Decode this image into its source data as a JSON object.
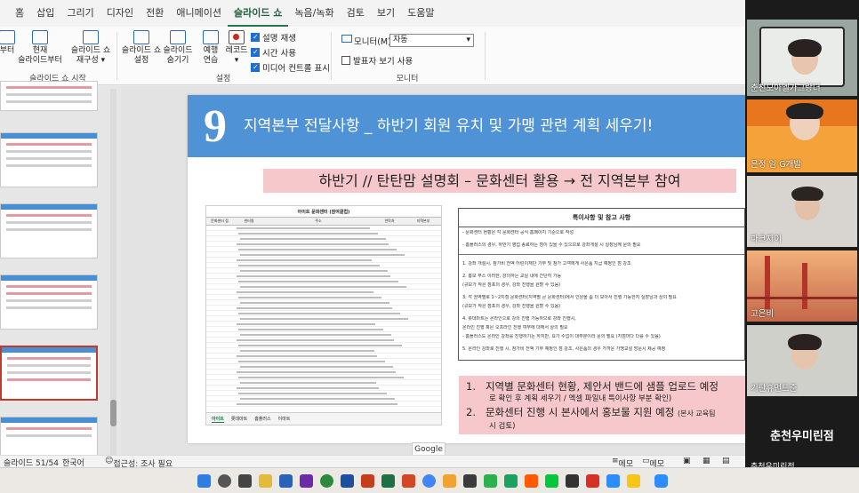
{
  "ribbon": {
    "tabs": [
      "홈",
      "삽입",
      "그리기",
      "디자인",
      "전환",
      "애니메이션",
      "슬라이드 쇼",
      "녹음/녹화",
      "검토",
      "보기",
      "도움말"
    ],
    "active_tab": "슬라이드 쇼",
    "groups": {
      "start": {
        "label": "슬라이드 쇼 시작",
        "buttons": [
          {
            "l1": "부터",
            "l2": ""
          },
          {
            "l1": "현재",
            "l2": "슬라이드부터"
          },
          {
            "l1": "슬라이드 쇼",
            "l2": "재구성 ▾"
          }
        ]
      },
      "setup": {
        "label": "설정",
        "buttons": [
          {
            "l1": "슬라이드 쇼",
            "l2": "설정"
          },
          {
            "l1": "슬라이드",
            "l2": "숨기기"
          },
          {
            "l1": "예행",
            "l2": "연습"
          },
          {
            "l1": "레코드",
            "l2": "▾"
          }
        ],
        "checks": [
          {
            "label": "설명 재생",
            "checked": true
          },
          {
            "label": "시간 사용",
            "checked": true
          },
          {
            "label": "미디어 컨트롤 표시",
            "checked": true
          }
        ]
      },
      "monitor": {
        "label": "모니터",
        "monitor_label": "모니터(M):",
        "monitor_value": "자동",
        "presenter_view": "발표자 보기 사용",
        "presenter_checked": false
      }
    }
  },
  "slide": {
    "number": "9",
    "title": "지역본부 전달사항 _ 하반기 회원 유치 및 가맹 관련 계획 세우기!",
    "subtitle": "하반기 //  탄탄맘 설명회 – 문화센터 활용 → 전 지역본부 참여",
    "sheet": {
      "title": "아이트 문화센터 (참여클럽)",
      "headers": [
        "문화센터 점",
        "센터명",
        "주소",
        "연락처",
        "지역본부"
      ],
      "tabs": [
        "아이트",
        "롯데마트",
        "홈플러스",
        "이마트"
      ],
      "active_tab": "아이트"
    },
    "notes": {
      "heading": "특이사항 및 참고 사항",
      "lines": [
        "- 문화센터 현황은 각 문화센터 공식 홈페이지 기준으로 작성",
        "- 홈플러스의 경우, 하반기 영업 종료하는 점이 있을 수 있으므로 강좌개설 시 실장님께 문의 필요",
        "1. 강좌 개설시, 참가비 전액 어린이재단 기부 및 참가 고객에게 사은품 지급 예정인 점 강조",
        "2. 홍보 부스 이러한, 강의하는 교실 내에 간단히 가능",
        "(규모가 작은 점포의 경우, 강좌 진행을 원할 수 있음)",
        "3. 각 권역별로 1~2지점 문화센터(지역별 큰 문화센터)에서 인원을 좀 더 모아서 진행 가능한지 실장님과 상의 필요",
        "(규모가 작은 점포의 경우, 강좌 진행을 원할 수 있음)",
        "4. 롯데마트는 온라인으로 강의 진행 가능하므로 강좌 진행시,",
        "온라인 진행 혹은 오프라인 진행 여부에 대해서 상의 필요",
        "- 홈플러스도 온라인 강좌를 진행하기는 하지만, 요가 수업이 대부분이라 문의 필요 (지점마다 다를 수 있음)",
        "5. 온라인 강좌로 진행 시, 참가비 전액 기부 예정인 점 강조, 사은품의 경우 가까운 가맹교실 방문시 제공 예정"
      ]
    },
    "bottom": {
      "item1": {
        "num": "1.",
        "text": "지역별 문화센터 현황, 제안서 밴드에 샘플 업로드 예정",
        "sub": "로 확인 후 계획 세우기 / 엑셀 파일내 특이사항 부분 확인)"
      },
      "item2": {
        "num": "2.",
        "text": "문화센터 진행 시 본사에서 홍보물 지원 예정",
        "small": "(본사 교육팀",
        "sub": "시 검토)"
      }
    }
  },
  "tooltip": "Google",
  "status": {
    "slide": "슬라이드 51/54",
    "language": "한국어",
    "accessibility": "접근성: 조사 필요",
    "notes": "메모",
    "comments": "메모"
  },
  "participants": [
    {
      "name": "춘천모아엘가그랑더"
    },
    {
      "name": "은정 임",
      "tag": "G개발"
    },
    {
      "name": "파크자이"
    },
    {
      "name": "고은비"
    },
    {
      "name": "기탄휴먼트준"
    }
  ],
  "host_big_name": "춘천우미린점",
  "host_small_name": "춘천우미린점",
  "colors": {
    "slide_header": "#4f93d6",
    "pink_box": "#f6c8cc",
    "accent_green": "#1f7a4a"
  }
}
